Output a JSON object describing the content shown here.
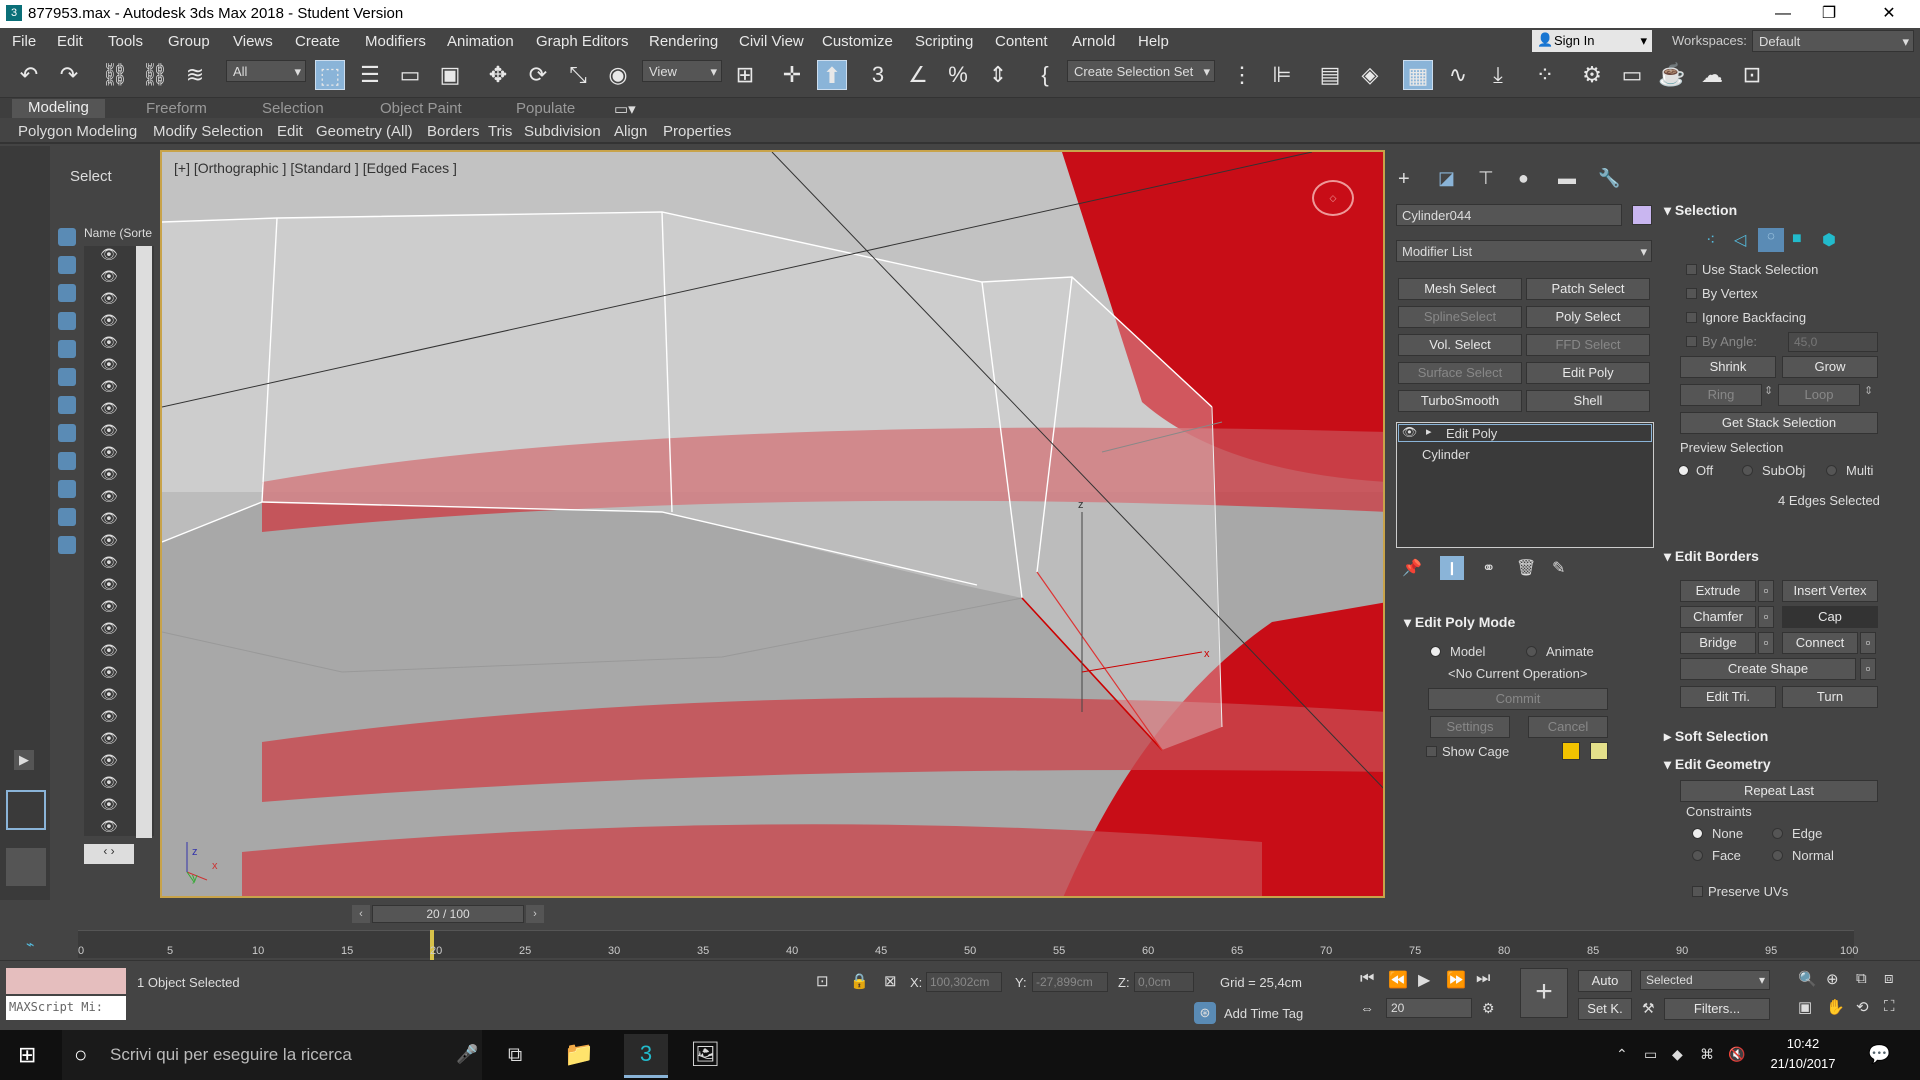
{
  "window": {
    "title": "877953.max - Autodesk 3ds Max 2018 - Student Version",
    "app_icon": "3ds-max-icon"
  },
  "menu": [
    "File",
    "Edit",
    "Tools",
    "Group",
    "Views",
    "Create",
    "Modifiers",
    "Animation",
    "Graph Editors",
    "Rendering",
    "Civil View",
    "Customize",
    "Scripting",
    "Content",
    "Arnold",
    "Help"
  ],
  "account": {
    "signin": "Sign In",
    "workspaces_label": "Workspaces:",
    "workspace": "Default"
  },
  "toolbar": {
    "filter": "All",
    "ref_coord": "View",
    "selection_set": "Create Selection Set"
  },
  "ribbon": {
    "tabs": [
      "Modeling",
      "Freeform",
      "Selection",
      "Object Paint",
      "Populate"
    ],
    "active": "Modeling",
    "subtabs": [
      "Polygon Modeling",
      "Modify Selection",
      "Edit",
      "Geometry (All)",
      "Borders",
      "Tris",
      "Subdivision",
      "Align",
      "Properties"
    ]
  },
  "scene_explorer": {
    "title": "Select",
    "column": "Name (Sorte"
  },
  "viewport": {
    "label": "[+] [Orthographic ] [Standard ] [Edged Faces ]",
    "axis_x": "x",
    "axis_z": "z",
    "axis_y": "y"
  },
  "command_panel": {
    "object_name": "Cylinder044",
    "modifier_list": "Modifier List",
    "modifier_buttons": [
      {
        "label": "Mesh Select",
        "enabled": true
      },
      {
        "label": "Patch Select",
        "enabled": true
      },
      {
        "label": "SplineSelect",
        "enabled": false
      },
      {
        "label": "Poly Select",
        "enabled": true
      },
      {
        "label": "Vol. Select",
        "enabled": true
      },
      {
        "label": "FFD Select",
        "enabled": false
      },
      {
        "label": "Surface Select",
        "enabled": false
      },
      {
        "label": "Edit Poly",
        "enabled": true
      },
      {
        "label": "TurboSmooth",
        "enabled": true
      },
      {
        "label": "Shell",
        "enabled": true
      }
    ],
    "stack": [
      "Edit Poly",
      "Cylinder"
    ],
    "edit_poly_mode": {
      "title": "Edit Poly Mode",
      "model": "Model",
      "animate": "Animate",
      "op": "<No Current Operation>",
      "commit": "Commit",
      "settings": "Settings",
      "cancel": "Cancel",
      "show_cage": "Show Cage"
    }
  },
  "selection": {
    "title": "Selection",
    "use_stack": "Use Stack Selection",
    "by_vertex": "By Vertex",
    "ignore_backfacing": "Ignore Backfacing",
    "by_angle": "By Angle:",
    "angle": "45,0",
    "shrink": "Shrink",
    "grow": "Grow",
    "ring": "Ring",
    "loop": "Loop",
    "get_stack": "Get Stack Selection",
    "preview": "Preview Selection",
    "off": "Off",
    "subobj": "SubObj",
    "multi": "Multi",
    "count": "4 Edges Selected"
  },
  "edit_borders": {
    "title": "Edit Borders",
    "extrude": "Extrude",
    "insert_vertex": "Insert Vertex",
    "chamfer": "Chamfer",
    "cap": "Cap",
    "bridge": "Bridge",
    "connect": "Connect",
    "create_shape": "Create Shape",
    "edit_tri": "Edit Tri.",
    "turn": "Turn"
  },
  "soft_selection": {
    "title": "Soft Selection"
  },
  "edit_geometry": {
    "title": "Edit Geometry",
    "repeat_last": "Repeat Last",
    "constraints": "Constraints",
    "none": "None",
    "edge": "Edge",
    "face": "Face",
    "normal": "Normal",
    "preserve_uvs": "Preserve UVs"
  },
  "timeline": {
    "frame": "20 / 100",
    "ticks": [
      "0",
      "5",
      "10",
      "15",
      "20",
      "25",
      "30",
      "35",
      "40",
      "45",
      "50",
      "55",
      "60",
      "65",
      "70",
      "75",
      "80",
      "85",
      "90",
      "95",
      "100"
    ]
  },
  "status": {
    "maxscript": "MAXScript Mi:",
    "objects": "1 Object Selected",
    "x_label": "X:",
    "x": "100,302cm",
    "y_label": "Y:",
    "y": "-27,899cm",
    "z_label": "Z:",
    "z": "0,0cm",
    "grid": "Grid = 25,4cm",
    "add_time_tag": "Add Time Tag",
    "auto": "Auto",
    "set_k": "Set K.",
    "key_filter": "Selected",
    "filters": "Filters...",
    "current_frame": "20"
  },
  "taskbar": {
    "search": "Scrivi qui per eseguire la ricerca",
    "time": "10:42",
    "date": "21/10/2017"
  }
}
